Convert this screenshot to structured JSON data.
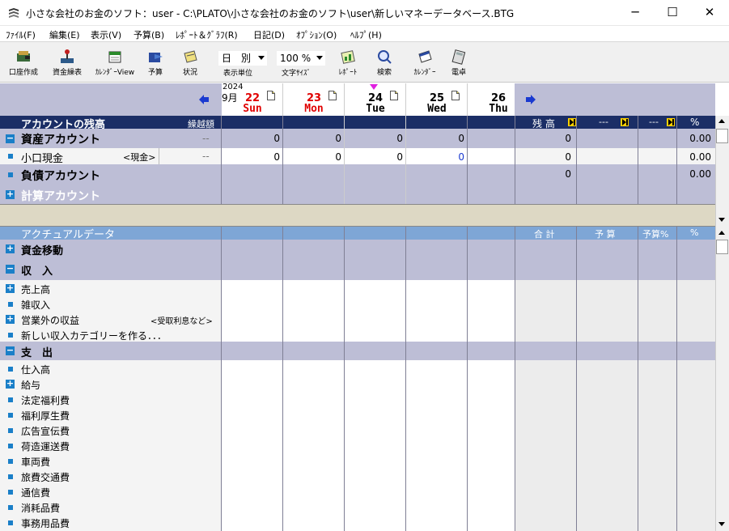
{
  "window": {
    "title": "小さな会社のお金のソフト：user - C:\\PLATO\\小さな会社のお金のソフト\\user\\新しいマネーデータベース.BTG",
    "minimize": "─",
    "maximize": "☐",
    "close": "✕"
  },
  "menu": [
    "ﾌｧｲﾙ(F)",
    "編集(E)",
    "表示(V)",
    "予算(B)",
    "ﾚﾎﾟｰﾄ＆ｸﾞﾗﾌ(R)",
    "日記(D)",
    "ｵﾌﾟｼｮﾝ(O)",
    "ﾍﾙﾌﾟ(H)"
  ],
  "toolbar": {
    "account": "口座作成",
    "ledger": "資金繰表",
    "calendar_view": "ｶﾚﾝﾀﾞｰView",
    "budget": "予算",
    "status": "状況",
    "unit_value": "日　別",
    "unit_label": "表示単位",
    "fontsize_value": "100 %",
    "fontsize_label": "文字ｻｲｽﾞ",
    "report": "ﾚﾎﾟｰﾄ",
    "search": "検索",
    "calendar": "ｶﾚﾝﾀﾞｰ",
    "calculator": "電卓"
  },
  "dates": {
    "year": "2024",
    "month": "9月",
    "days": [
      {
        "day": "22",
        "dow": "Sun",
        "color": "#e00000"
      },
      {
        "day": "23",
        "dow": "Mon",
        "color": "#e00000"
      },
      {
        "day": "24",
        "dow": "Tue",
        "color": "#000000"
      },
      {
        "day": "25",
        "dow": "Wed",
        "color": "#000000"
      },
      {
        "day": "26",
        "dow": "Thu",
        "color": "#000000"
      }
    ]
  },
  "balance": {
    "header": "アカウントの残高",
    "carry": "繰越額",
    "balance_col": "残 高",
    "dash1": "---",
    "dash2": "---",
    "pct": "%",
    "asset": {
      "label": "資産アカウント",
      "carry": "--",
      "values": [
        "0",
        "0",
        "0",
        "0"
      ],
      "balance": "0",
      "pct": "0.00"
    },
    "cash": {
      "label": "小口現金",
      "tag": "<現金>",
      "carry": "--",
      "values": [
        "0",
        "0",
        "0",
        "0"
      ],
      "balance": "0",
      "pct": "0.00"
    },
    "liability": {
      "label": "負債アカウント",
      "balance": "0",
      "pct": "0.00"
    },
    "calc": {
      "label": "計算アカウント"
    }
  },
  "actual": {
    "header": "アクチュアルデータ",
    "total": "合 計",
    "budget": "予 算",
    "budget_pct": "予算%",
    "pct": "%",
    "transfer": "資金移動",
    "income_header": "収　入",
    "income_items": [
      {
        "label": "売上高",
        "icon": "plus"
      },
      {
        "label": "雑収入",
        "icon": "dot"
      },
      {
        "label": "営業外の収益",
        "tag": "<受取利息など>",
        "icon": "plus"
      },
      {
        "label": "新しい収入カテゴリーを作る．．．",
        "icon": "dot"
      }
    ],
    "expense_header": "支　出",
    "expense_items": [
      {
        "label": "仕入高",
        "icon": "dot"
      },
      {
        "label": "給与",
        "icon": "plus"
      },
      {
        "label": "法定福利費",
        "icon": "dot"
      },
      {
        "label": "福利厚生費",
        "icon": "dot"
      },
      {
        "label": "広告宣伝費",
        "icon": "dot"
      },
      {
        "label": "荷造運送費",
        "icon": "dot"
      },
      {
        "label": "車両費",
        "icon": "dot"
      },
      {
        "label": "旅費交通費",
        "icon": "dot"
      },
      {
        "label": "通信費",
        "icon": "dot"
      },
      {
        "label": "消耗品費",
        "icon": "dot"
      },
      {
        "label": "事務用品費",
        "icon": "dot"
      }
    ]
  }
}
